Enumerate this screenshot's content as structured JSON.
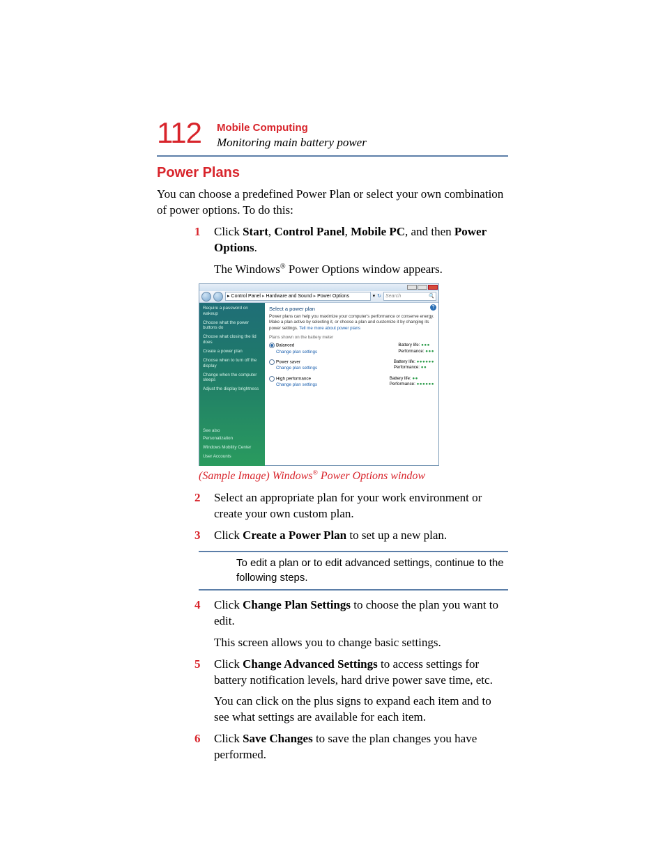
{
  "page_number": "112",
  "chapter": "Mobile Computing",
  "section": "Monitoring main battery power",
  "heading": "Power Plans",
  "intro": "You can choose a predefined Power Plan or select your own combination of power options. To do this:",
  "steps": {
    "s1_pre": "Click ",
    "s1_b1": "Start",
    "s1_c1": ", ",
    "s1_b2": "Control Panel",
    "s1_c2": ", ",
    "s1_b3": "Mobile PC",
    "s1_c3": ", and then ",
    "s1_b4": "Power Options",
    "s1_post": ".",
    "s1_result_a": "The Windows",
    "s1_result_b": " Power Options window appears.",
    "s2": "Select an appropriate plan for your work environment or create your own custom plan.",
    "s3_pre": "Click ",
    "s3_b": "Create a Power Plan",
    "s3_post": " to set up a new plan.",
    "note": "To edit a plan or to edit advanced settings, continue to the following steps.",
    "s4_pre": "Click ",
    "s4_b": "Change Plan Settings",
    "s4_post": " to choose the plan you want to edit.",
    "s4_extra": "This screen allows you to change basic settings.",
    "s5_pre": "Click ",
    "s5_b": "Change Advanced Settings",
    "s5_post": " to access settings for battery notification levels, hard drive power save time, etc.",
    "s5_extra": "You can click on the plus signs to expand each item and to see what settings are available for each item.",
    "s6_pre": "Click ",
    "s6_b": "Save Changes",
    "s6_post": " to save the plan changes you have performed."
  },
  "caption_a": "(Sample Image) Windows",
  "caption_b": " Power Options window",
  "screenshot": {
    "breadcrumb": [
      "Control Panel",
      "Hardware and Sound",
      "Power Options"
    ],
    "search_placeholder": "Search",
    "sidebar": {
      "links": [
        "Require a password on wakeup",
        "Choose what the power buttons do",
        "Choose what closing the lid does",
        "Create a power plan",
        "Choose when to turn off the display",
        "Change when the computer sleeps",
        "Adjust the display brightness"
      ],
      "see_also_hd": "See also",
      "see_also": [
        "Personalization",
        "Windows Mobility Center",
        "User Accounts"
      ]
    },
    "main": {
      "heading": "Select a power plan",
      "desc": "Power plans can help you maximize your computer's performance or conserve energy. Make a plan active by selecting it, or choose a plan and customize it by changing its power settings. ",
      "desc_link": "Tell me more about power plans",
      "legend": "Plans shown on the battery meter",
      "change_link": "Change plan settings",
      "batt_label": "Battery life: ",
      "perf_label": "Performance: ",
      "plans": [
        {
          "name": "Balanced",
          "selected": true,
          "batt": "●●●",
          "perf": "●●●"
        },
        {
          "name": "Power saver",
          "selected": false,
          "batt": "●●●●●●",
          "perf": "●●"
        },
        {
          "name": "High performance",
          "selected": false,
          "batt": "●●",
          "perf": "●●●●●●"
        }
      ]
    }
  }
}
